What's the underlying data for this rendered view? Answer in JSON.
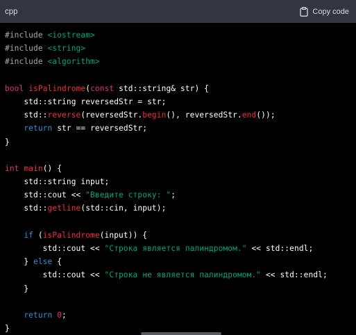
{
  "header": {
    "language": "cpp",
    "copy_label": "Copy code",
    "copy_icon": "clipboard-icon"
  },
  "colors": {
    "header_bg": "#343541",
    "code_bg": "#000000",
    "preprocessor": "#a9a9a9",
    "keyword": "#2e95d3",
    "string": "#00a67d",
    "function": "#f22c3d",
    "type_keyword": "#df3079",
    "plain": "#ffffff"
  },
  "code_lines": [
    [
      [
        "pp",
        "#include "
      ],
      [
        "str",
        "<iostream>"
      ]
    ],
    [
      [
        "pp",
        "#include "
      ],
      [
        "str",
        "<string>"
      ]
    ],
    [
      [
        "pp",
        "#include "
      ],
      [
        "str",
        "<algorithm>"
      ]
    ],
    [],
    [
      [
        "type",
        "bool"
      ],
      [
        "plain",
        " "
      ],
      [
        "fn",
        "isPalindrome"
      ],
      [
        "plain",
        "("
      ],
      [
        "type",
        "const"
      ],
      [
        "plain",
        " std::string& str) {"
      ]
    ],
    [
      [
        "plain",
        "    std::string reversedStr = str;"
      ]
    ],
    [
      [
        "plain",
        "    std::"
      ],
      [
        "fn",
        "reverse"
      ],
      [
        "plain",
        "(reversedStr."
      ],
      [
        "fn",
        "begin"
      ],
      [
        "plain",
        "(), reversedStr."
      ],
      [
        "fn",
        "end"
      ],
      [
        "plain",
        "());"
      ]
    ],
    [
      [
        "plain",
        "    "
      ],
      [
        "kw",
        "return"
      ],
      [
        "plain",
        " str == reversedStr;"
      ]
    ],
    [
      [
        "plain",
        "}"
      ]
    ],
    [],
    [
      [
        "type",
        "int"
      ],
      [
        "plain",
        " "
      ],
      [
        "fn",
        "main"
      ],
      [
        "plain",
        "() {"
      ]
    ],
    [
      [
        "plain",
        "    std::string input;"
      ]
    ],
    [
      [
        "plain",
        "    std::cout << "
      ],
      [
        "str",
        "\"Введите строку: \""
      ],
      [
        "plain",
        ";"
      ]
    ],
    [
      [
        "plain",
        "    std::"
      ],
      [
        "fn",
        "getline"
      ],
      [
        "plain",
        "(std::cin, input);"
      ]
    ],
    [],
    [
      [
        "plain",
        "    "
      ],
      [
        "kw",
        "if"
      ],
      [
        "plain",
        " ("
      ],
      [
        "fn",
        "isPalindrome"
      ],
      [
        "plain",
        "(input)) {"
      ]
    ],
    [
      [
        "plain",
        "        std::cout << "
      ],
      [
        "str",
        "\"Строка является палиндромом.\""
      ],
      [
        "plain",
        " << std::endl;"
      ]
    ],
    [
      [
        "plain",
        "    } "
      ],
      [
        "kw",
        "else"
      ],
      [
        "plain",
        " {"
      ]
    ],
    [
      [
        "plain",
        "        std::cout << "
      ],
      [
        "str",
        "\"Строка не является палиндромом.\""
      ],
      [
        "plain",
        " << std::endl;"
      ]
    ],
    [
      [
        "plain",
        "    }"
      ]
    ],
    [],
    [
      [
        "plain",
        "    "
      ],
      [
        "kw",
        "return"
      ],
      [
        "plain",
        " "
      ],
      [
        "num",
        "0"
      ],
      [
        "plain",
        ";"
      ]
    ],
    [
      [
        "plain",
        "}"
      ]
    ]
  ]
}
